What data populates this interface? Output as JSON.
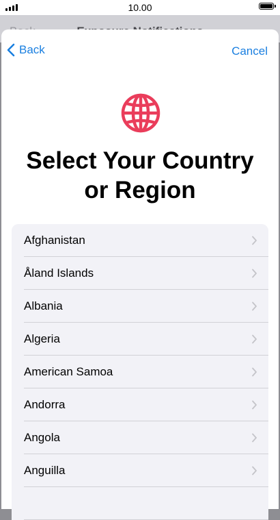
{
  "status_bar": {
    "time": "10.00",
    "signal_icon": "signal-bars-icon",
    "battery_icon": "battery-icon",
    "battery_level": 1.0
  },
  "background_screen": {
    "back_label": "Back",
    "title": "Exposure Notifications"
  },
  "nav": {
    "back_label": "Back",
    "cancel_label": "Cancel"
  },
  "header": {
    "icon": "globe-icon",
    "title_line1": "Select Your Country",
    "title_line2": "or Region"
  },
  "countries": [
    "Afghanistan",
    "Åland Islands",
    "Albania",
    "Algeria",
    "American Samoa",
    "Andorra",
    "Angola",
    "Anguilla",
    ""
  ],
  "colors": {
    "accent": "#1a7fe0",
    "globe": "#ea3d5b",
    "list_background": "#f2f2f7",
    "separator": "#d1d1d6",
    "chevron": "#c4c4c9"
  }
}
